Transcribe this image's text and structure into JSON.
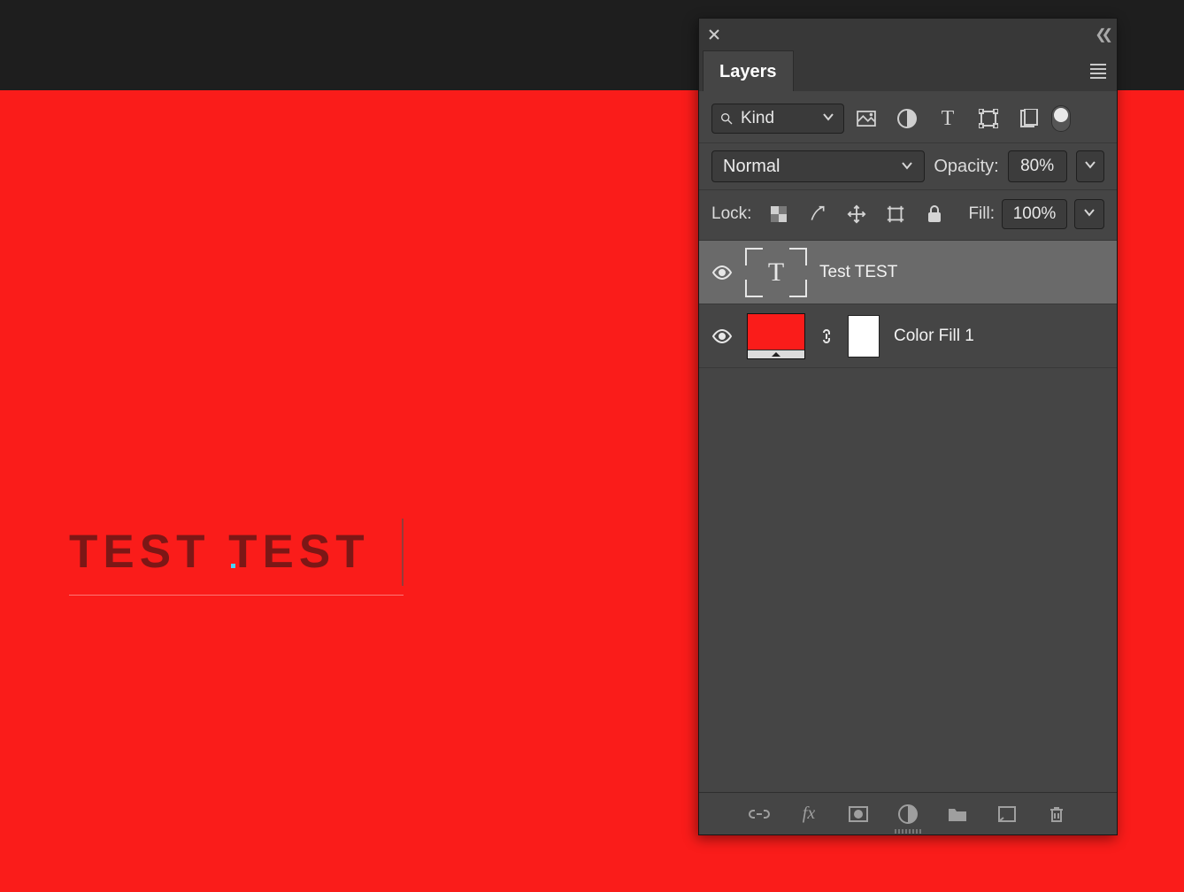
{
  "canvas": {
    "background": "#fa1c1a",
    "text": "TEST TEST"
  },
  "panel": {
    "tab": "Layers",
    "filter": {
      "kind": "Kind"
    },
    "blend": {
      "mode": "Normal",
      "opacity_label": "Opacity:",
      "opacity_value": "80%"
    },
    "lock": {
      "label": "Lock:",
      "fill_label": "Fill:",
      "fill_value": "100%"
    },
    "layers": [
      {
        "name": "Test TEST",
        "type": "text",
        "selected": true
      },
      {
        "name": "Color Fill 1",
        "type": "fill",
        "selected": false
      }
    ]
  }
}
